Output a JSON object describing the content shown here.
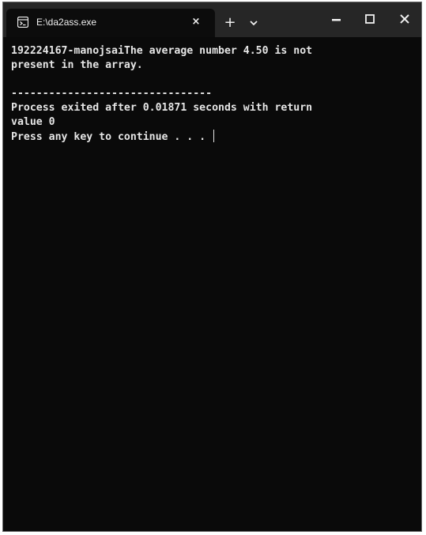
{
  "window": {
    "tab_title": "E:\\da2ass.exe",
    "tab_close_glyph": "×",
    "new_tab_glyph": "+",
    "icons": [
      "terminal-icon",
      "close-icon",
      "plus-icon",
      "chevron-down-icon",
      "minimize-icon",
      "maximize-icon",
      "close-window-icon"
    ]
  },
  "console": {
    "lines": [
      "192224167-manojsaiThe average number 4.50 is not",
      "present in the array.",
      "",
      "--------------------------------",
      "Process exited after 0.01871 seconds with return",
      "value 0",
      "Press any key to continue . . . "
    ]
  },
  "colors": {
    "background": "#0a0a0a",
    "titlebar": "#262626",
    "text": "#e6e6e6"
  }
}
